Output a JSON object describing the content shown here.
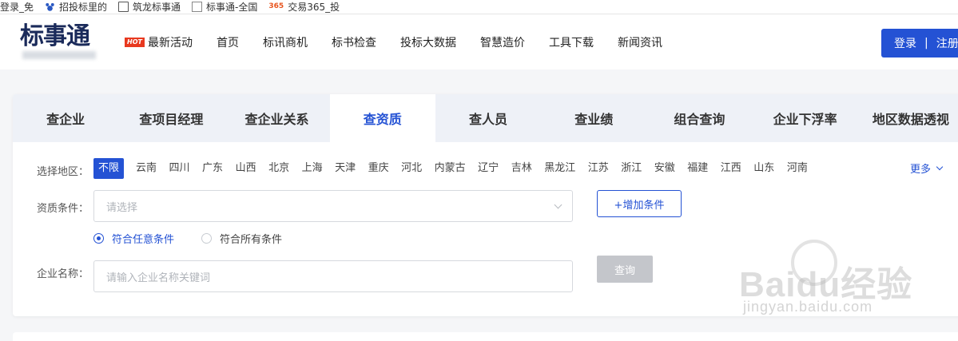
{
  "bookmarks": [
    {
      "icon": "page-icon",
      "label": "登录_免"
    },
    {
      "icon": "paw-icon",
      "label": "招投标里的"
    },
    {
      "icon": "doc-icon",
      "label": "筑龙标事通"
    },
    {
      "icon": "page-icon",
      "label": "标事通-全国"
    },
    {
      "icon": "s365-icon",
      "label": "交易365_投",
      "icon_text": "365"
    }
  ],
  "header": {
    "logo": "标事通",
    "nav": [
      {
        "label": "最新活动",
        "badge": "HOT"
      },
      {
        "label": "首页"
      },
      {
        "label": "标讯商机"
      },
      {
        "label": "标书检查"
      },
      {
        "label": "投标大数据"
      },
      {
        "label": "智慧造价"
      },
      {
        "label": "工具下载"
      },
      {
        "label": "新闻资讯"
      }
    ],
    "login": "登录",
    "separator": "|",
    "register": "注册"
  },
  "tabs": [
    {
      "label": "查企业",
      "active": false
    },
    {
      "label": "查项目经理",
      "active": false
    },
    {
      "label": "查企业关系",
      "active": false
    },
    {
      "label": "查资质",
      "active": true
    },
    {
      "label": "查人员",
      "active": false
    },
    {
      "label": "查业绩",
      "active": false
    },
    {
      "label": "组合查询",
      "active": false
    },
    {
      "label": "企业下浮率",
      "active": false
    },
    {
      "label": "地区数据透视",
      "active": false
    }
  ],
  "search": {
    "region_label": "选择地区：",
    "regions": [
      "不限",
      "云南",
      "四川",
      "广东",
      "山西",
      "北京",
      "上海",
      "天津",
      "重庆",
      "河北",
      "内蒙古",
      "辽宁",
      "吉林",
      "黑龙江",
      "江苏",
      "浙江",
      "安徽",
      "福建",
      "江西",
      "山东",
      "河南"
    ],
    "active_region": "不限",
    "more": "更多",
    "qualification_label": "资质条件：",
    "qualification_placeholder": "请选择",
    "add_condition": "+增加条件",
    "match_any": "符合任意条件",
    "match_all": "符合所有条件",
    "match_selected": "any",
    "company_label": "企业名称：",
    "company_placeholder": "请输入企业名称关键词",
    "query": "查询"
  },
  "watermark": {
    "text": "Baidu经验",
    "url": "jingyan.baidu.com"
  },
  "colors": {
    "accent": "#2452d4",
    "query_disabled": "#c4c6cb",
    "hot_badge": "#e8391f"
  }
}
